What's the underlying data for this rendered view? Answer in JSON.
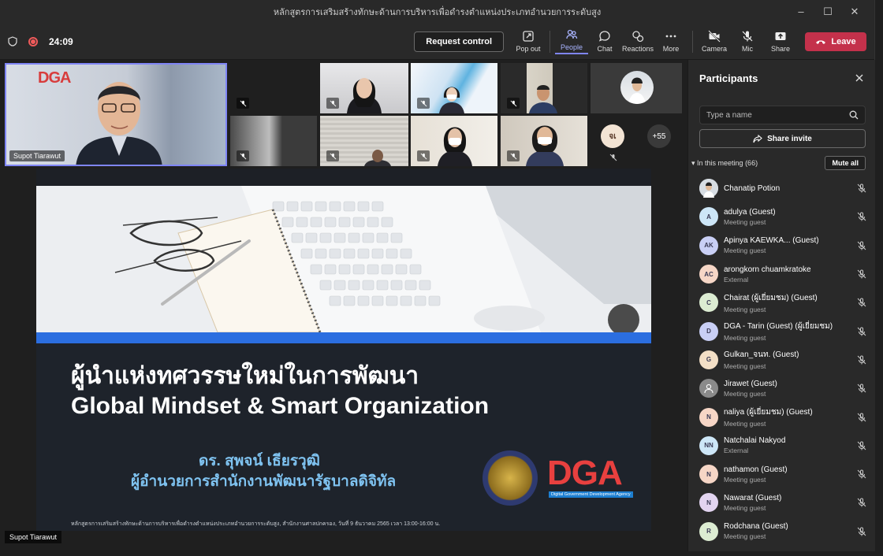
{
  "window": {
    "title": "หลักสูตรการเสริมสร้างทักษะด้านการบริหารเพื่อดำรงตำแหน่งประเภทอำนวยการระดับสูง"
  },
  "toolbar": {
    "timer": "24:09",
    "request_control": "Request control",
    "tools": [
      {
        "label": "Pop out",
        "icon": "popout-icon"
      },
      {
        "label": "People",
        "icon": "people-icon",
        "active": true
      },
      {
        "label": "Chat",
        "icon": "chat-icon"
      },
      {
        "label": "Reactions",
        "icon": "reactions-icon"
      },
      {
        "label": "More",
        "icon": "more-icon"
      },
      {
        "label": "Camera",
        "icon": "camera-off-icon"
      },
      {
        "label": "Mic",
        "icon": "mic-off-icon"
      },
      {
        "label": "Share",
        "icon": "share-icon"
      }
    ],
    "leave": "Leave"
  },
  "stage": {
    "speaker_name": "Supot Tiarawut",
    "speaker_logo": "DGA",
    "overflow_avatar": "จเ",
    "overflow_count": "+55",
    "bottom_name": "Supot Tiarawut"
  },
  "slide": {
    "title_th": "ผู้นำแห่งทศวรรษใหม่ในการพัฒนา",
    "title_en": "Global Mindset & Smart Organization",
    "presenter_name": "ดร. สุพจน์ เธียรวุฒิ",
    "presenter_role": "ผู้อำนวยการสำนักงานพัฒนารัฐบาลดิจิทัล",
    "footnote": "หลักสูตรการเสริมสร้างทักษะด้านการบริหารเพื่อดำรงตำแหน่งประเภทอำนวยการระดับสูง, สำนักงานศาลปกครอง, วันที่ 9 ธันวาคม 2565 เวลา 13:00-16:00 น.",
    "logo_text": "DGA",
    "logo_sub": "Digital Government Development Agency"
  },
  "panel": {
    "title": "Participants",
    "search_placeholder": "Type a name",
    "share_invite": "Share invite",
    "in_meeting": "In this meeting (66)",
    "mute_all": "Mute all",
    "participants": [
      {
        "initials": "",
        "name": "Chanatip Potion",
        "role": "",
        "color": "#cfd8e3",
        "photo": true
      },
      {
        "initials": "A",
        "name": "adulya (Guest)",
        "role": "Meeting guest",
        "color": "#cde6f7"
      },
      {
        "initials": "AK",
        "name": "Apinya KAEWKA...  (Guest)",
        "role": "Meeting guest",
        "color": "#c9cff5"
      },
      {
        "initials": "AC",
        "name": "arongkorn chuamkratoke",
        "role": "External",
        "color": "#f6d6c6"
      },
      {
        "initials": "C",
        "name": "Chairat (ผู้เยี่ยมชม) (Guest)",
        "role": "Meeting guest",
        "color": "#dcecd2"
      },
      {
        "initials": "D",
        "name": "DGA - Tarin (Guest) (ผู้เยี่ยมชม)",
        "role": "Meeting guest",
        "color": "#c9cff5"
      },
      {
        "initials": "G",
        "name": "Gulkan_จนท. (Guest)",
        "role": "Meeting guest",
        "color": "#f3dfc6"
      },
      {
        "initials": "",
        "name": "Jirawet (Guest)",
        "role": "Meeting guest",
        "color": "#8a8a8a",
        "generic": true
      },
      {
        "initials": "N",
        "name": "naliya (ผู้เยี่ยมชม) (Guest)",
        "role": "Meeting guest",
        "color": "#f6d6c6"
      },
      {
        "initials": "NN",
        "name": "Natchalai Nakyod",
        "role": "External",
        "color": "#cde6f7"
      },
      {
        "initials": "N",
        "name": "nathamon (Guest)",
        "role": "Meeting guest",
        "color": "#f6d6c6"
      },
      {
        "initials": "N",
        "name": "Nawarat (Guest)",
        "role": "Meeting guest",
        "color": "#e2d4f0"
      },
      {
        "initials": "R",
        "name": "Rodchana (Guest)",
        "role": "Meeting guest",
        "color": "#dcecd2"
      }
    ]
  },
  "colors": {
    "accent": "#7f85f5",
    "leave": "#c4314b",
    "slide_blue": "#2b6ee0",
    "slide_text_blue": "#7fc3f1",
    "dga_red": "#e8403f"
  }
}
